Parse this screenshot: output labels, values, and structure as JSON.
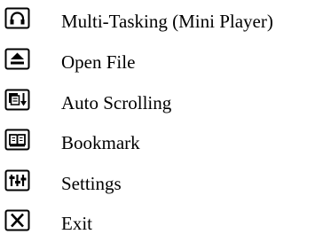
{
  "menu": {
    "items": [
      {
        "label": "Multi-Tasking (Mini Player)",
        "icon": "headphones-icon"
      },
      {
        "label": "Open File",
        "icon": "eject-icon"
      },
      {
        "label": "Auto Scrolling",
        "icon": "auto-scroll-icon"
      },
      {
        "label": "Bookmark",
        "icon": "book-icon"
      },
      {
        "label": "Settings",
        "icon": "settings-icon"
      },
      {
        "label": "Exit",
        "icon": "close-icon"
      }
    ]
  },
  "colors": {
    "icon_border": "#000000",
    "icon_fill": "#ffffff",
    "text": "#000000"
  }
}
